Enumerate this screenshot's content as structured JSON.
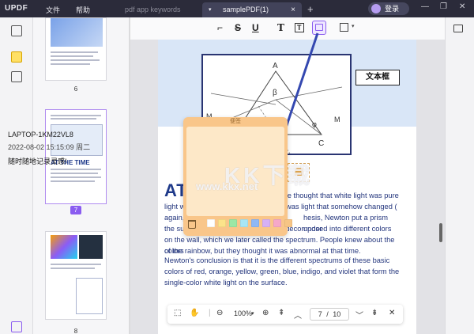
{
  "app": {
    "logo": "UPDF",
    "menu": [
      "文件",
      "帮助"
    ],
    "tabs": [
      {
        "label": "pdf app keywords",
        "active": false
      },
      {
        "label": "samplePDF(1)",
        "active": true
      }
    ],
    "add_tab": "+",
    "login": "登录",
    "window_controls": [
      "—",
      "❐",
      "✕"
    ]
  },
  "toolbar": {
    "items": [
      {
        "name": "highlight-tool",
        "glyph": "🖍"
      },
      {
        "name": "strikethrough-tool",
        "glyph": "S"
      },
      {
        "name": "underline-tool",
        "glyph": "U"
      },
      {
        "name": "text-tool",
        "glyph": "T"
      },
      {
        "name": "textbox-tool",
        "glyph": "T"
      },
      {
        "name": "sticky-note-tool",
        "glyph": ""
      },
      {
        "name": "shape-tool",
        "glyph": ""
      }
    ]
  },
  "thumbnails": [
    {
      "page": "6"
    },
    {
      "page": "7",
      "selected": true,
      "title": "AT THE TIME"
    },
    {
      "page": "8"
    }
  ],
  "figure": {
    "labels": [
      "A",
      "β",
      "M",
      "M",
      "φ",
      "C",
      "B"
    ],
    "textbox_label": "文本框"
  },
  "document": {
    "title": "AT",
    "para1": [
      "light w",
      "again,",
      "the su",
      "on the wall, which we later called the spectrum. People knew about the colors",
      "of the rainbow, but they thought it was abnormal at that time."
    ],
    "para1_right": [
      "me thought that white light was pure",
      "was light that somehow changed (",
      "hesis, Newton put a prism under",
      "s decomposed into different colors"
    ],
    "para2": "Newton's conclusion is that it is the different spectrums of these basic colors of red, orange, yellow, green, blue, indigo, and violet that form the single-color white light on the surface."
  },
  "note": {
    "header": "便签",
    "author": "LAPTOP-1KM22VL8",
    "time": "2022-08-02 15:15:09 周二",
    "content": "随时随地记录灵感!",
    "colors": [
      "#ffffff",
      "#fce38a",
      "#9be7a5",
      "#a8e6f5",
      "#8fb8f5",
      "#d6b0f5",
      "#f5a8c8",
      "#f7c585"
    ]
  },
  "watermark": {
    "cn": "KK下载",
    "url": "www.kkx.net"
  },
  "nav": {
    "zoom": "100%",
    "current_page": "7",
    "sep": "/",
    "total_pages": "10"
  },
  "colors": {
    "accent": "#8a5cf0",
    "title_bar": "#2b2b3a",
    "doc_text": "#24367d"
  }
}
